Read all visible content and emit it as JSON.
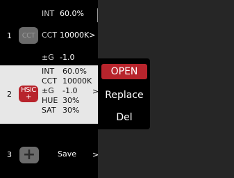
{
  "colors": {
    "accent": "#b8242c",
    "panel_bg": "#000000",
    "selected_bg": "#e7e7e7",
    "background": "#262626"
  },
  "presets": {
    "slot1": {
      "number": "1",
      "badge": "CCT",
      "rows": [
        {
          "key": "INT",
          "value": "60.0%"
        },
        {
          "key": "CCT",
          "value": "10000K"
        },
        {
          "key": "±G",
          "value": "-1.0"
        }
      ],
      "chevron": ">"
    },
    "slot2": {
      "number": "2",
      "badge": "HSIC",
      "badge_plus": "+",
      "rows": [
        {
          "key": "INT",
          "value": "60.0%"
        },
        {
          "key": "CCT",
          "value": "10000K"
        },
        {
          "key": "±G",
          "value": "-1.0"
        },
        {
          "key": "HUE",
          "value": "30%"
        },
        {
          "key": "SAT",
          "value": "30%"
        }
      ],
      "chevron": ">"
    },
    "slot3": {
      "number": "3",
      "add_icon": "+",
      "save_label": "Save",
      "chevron": ">"
    }
  },
  "menu": {
    "items": [
      "OPEN",
      "Replace",
      "Del"
    ]
  }
}
